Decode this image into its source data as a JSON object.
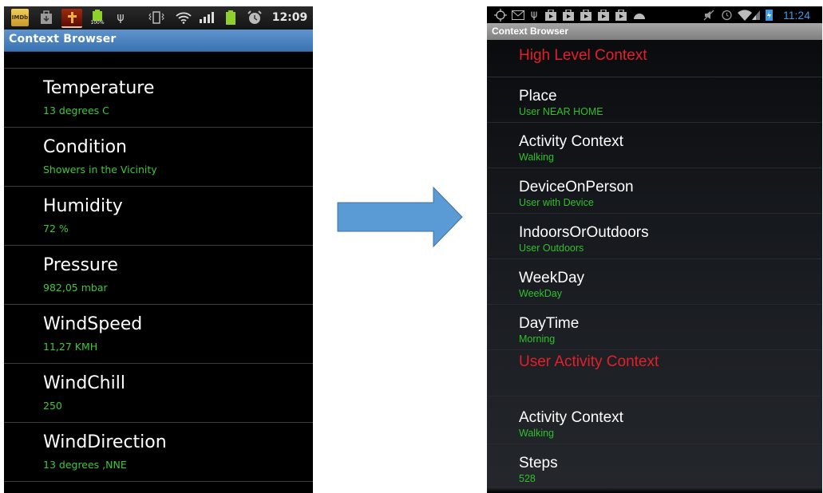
{
  "left_phone": {
    "status_bar": {
      "icons": [
        "imdb-app-icon",
        "download-icon",
        "bible-app-icon",
        "battery-100-icon",
        "usb-icon",
        "vibrate-icon",
        "wifi-icon",
        "signal-icon",
        "battery-icon",
        "alarm-icon"
      ],
      "battery_badge": "100%",
      "time": "12:09"
    },
    "title": "Context Browser",
    "items": [
      {
        "label": "Temperature",
        "value": "13 degrees C"
      },
      {
        "label": "Condition",
        "value": "Showers in the Vicinity"
      },
      {
        "label": "Humidity",
        "value": "72 %"
      },
      {
        "label": "Pressure",
        "value": "982,05 mbar"
      },
      {
        "label": "WindSpeed",
        "value": "11,27 KMH"
      },
      {
        "label": "WindChill",
        "value": "250"
      },
      {
        "label": "WindDirection",
        "value": "13 degrees ,NNE"
      }
    ]
  },
  "arrow": {
    "direction": "right",
    "color": "#5b9bd5",
    "stroke": "#41719c"
  },
  "right_phone": {
    "status_bar": {
      "icons": [
        "gps-icon",
        "gmail-icon",
        "usb-icon",
        "store-icon",
        "store-icon",
        "store-icon",
        "store-icon",
        "store-icon",
        "android-icon",
        "mute-icon",
        "alarm-icon",
        "wifi-icon",
        "signal-icon",
        "battery-charging-icon"
      ],
      "time": "11:24"
    },
    "title": "Context Browser",
    "sections": [
      {
        "header": "High Level Context",
        "items": [
          {
            "label": "Place",
            "value": "User NEAR HOME"
          },
          {
            "label": "Activity Context",
            "value": "Walking"
          },
          {
            "label": "DeviceOnPerson",
            "value": "User with Device"
          },
          {
            "label": "IndoorsOrOutdoors",
            "value": "User Outdoors"
          },
          {
            "label": "WeekDay",
            "value": "WeekDay"
          },
          {
            "label": "DayTime",
            "value": "Morning"
          }
        ]
      },
      {
        "header": "User Activity Context",
        "items": [
          {
            "label": "Activity Context",
            "value": "Walking"
          },
          {
            "label": "Steps",
            "value": "528"
          }
        ]
      }
    ],
    "colors": {
      "header": "#e3202a",
      "value": "#2fc12b"
    }
  }
}
